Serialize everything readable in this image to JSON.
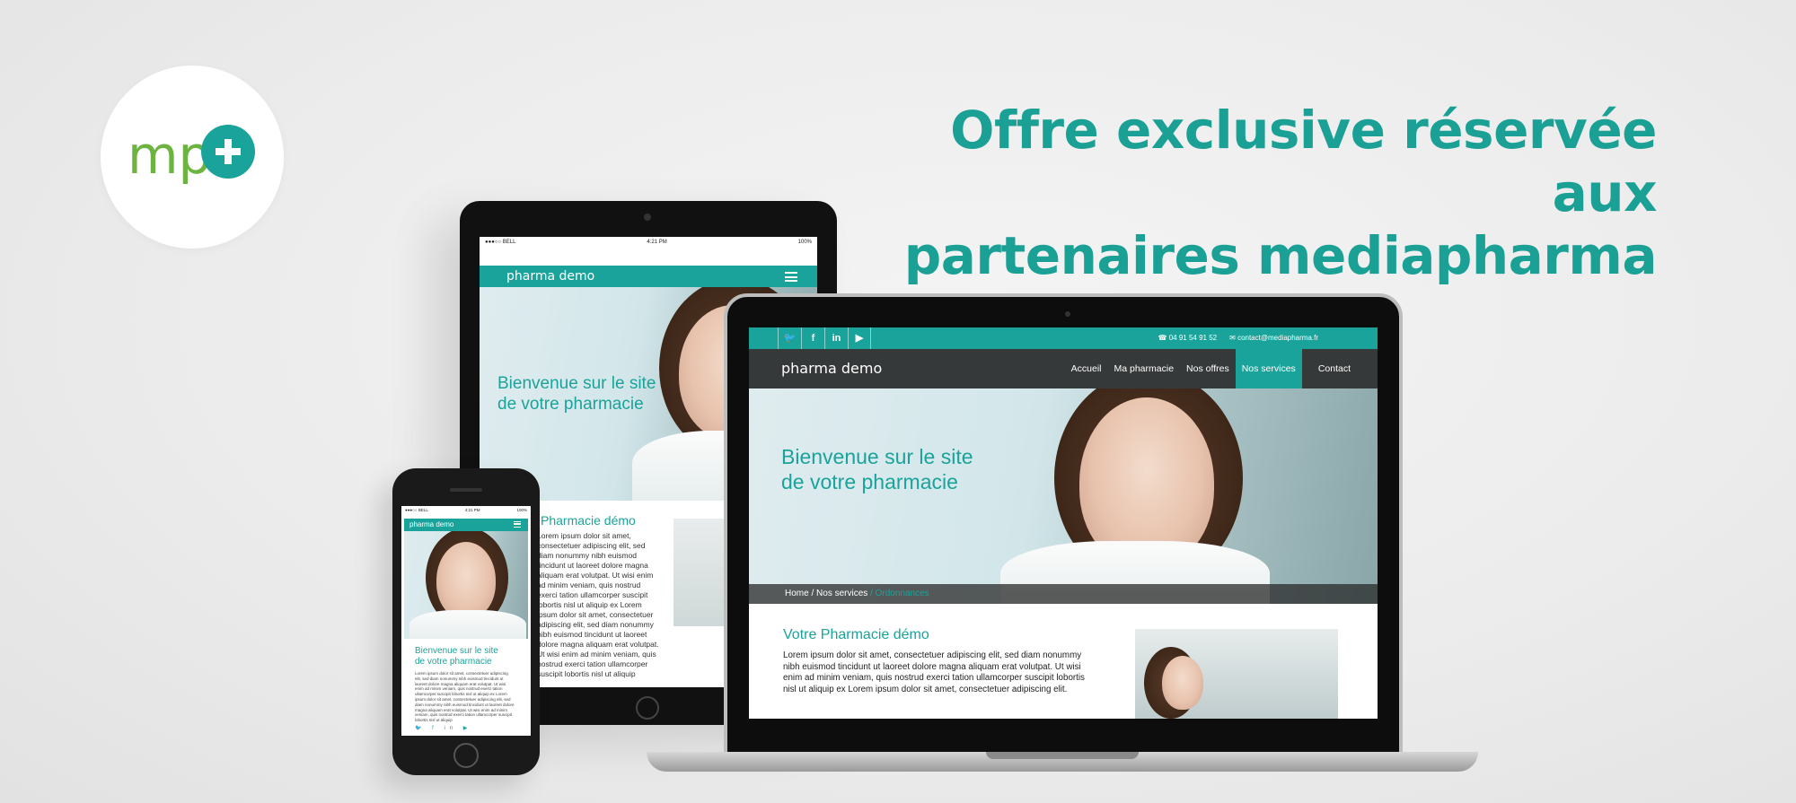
{
  "logo": {
    "text": "mp",
    "icon": "plus-icon"
  },
  "headline": {
    "line1": "Offre exclusive réservée aux",
    "line2": "partenaires mediapharma"
  },
  "colors": {
    "teal": "#1aa39a",
    "dark_nav": "#363939",
    "logo_green": "#6cb33f"
  },
  "tablet": {
    "status": {
      "carrier": "●●●○○ BELL",
      "time": "4:21 PM",
      "battery": "100%"
    },
    "brand": "pharma demo",
    "welcome": [
      "Bienvenue sur le site",
      "de votre pharmacie"
    ],
    "section_title": "Pharmacie démo",
    "section_text": "Lorem ipsum dolor sit amet, consectetuer adipiscing elit, sed diam nonummy nibh euismod tincidunt ut laoreet dolore magna aliquam erat volutpat. Ut wisi enim ad minim veniam, quis nostrud exerci tation ullamcorper suscipit lobortis nisl ut aliquip ex Lorem ipsum dolor sit amet, consectetuer adipiscing elit, sed diam nonummy nibh euismod tincidunt ut laoreet dolore magna aliquam erat volutpat. Ut wisi enim ad minim veniam, quis nostrud exerci tation ullamcorper suscipit lobortis nisl ut aliquip"
  },
  "phone": {
    "status": {
      "carrier": "●●●○○ BELL",
      "time": "4:21 PM",
      "battery": "100%"
    },
    "brand": "pharma demo",
    "welcome": [
      "Bienvenue sur le site",
      "de votre pharmacie"
    ],
    "text": "Lorem ipsum dolor sit amet, consectetuer adipiscing elit, sed diam nonummy nibh euismod tincidunt ut laoreet dolore magna aliquam erat volutpat. Ut wisi enim ad minim veniam, quis nostrud exerci tation ullamcorper suscipit lobortis nisl ut aliquip ex Lorem ipsum dolor sit amet, consectetuer adipiscing elit, sed diam nonummy nibh euismod tincidunt ut laoreet dolore magna aliquam erat volutpat. Ut wisi enim ad minim veniam, quis nostrud exerci tation ullamcorper suscipit lobortis nisl ut aliquip",
    "social": "🐦 f in ▶"
  },
  "laptop": {
    "social_icons": [
      "twitter-icon",
      "facebook-icon",
      "linkedin-icon",
      "youtube-icon"
    ],
    "social_glyphs": [
      "🐦",
      "f",
      "in",
      "▶"
    ],
    "phone": "04 91 54 91 52",
    "email": "contact@mediapharma.fr",
    "brand": "pharma demo",
    "menu": [
      "Accueil",
      "Ma pharmacie",
      "Nos offres",
      "Nos services",
      "Contact"
    ],
    "active_menu": "Nos services",
    "welcome": [
      "Bienvenue sur le site",
      "de votre pharmacie"
    ],
    "breadcrumb": {
      "home": "Home",
      "sep": "/",
      "section": "Nos services",
      "current": "Ordonnances"
    },
    "content_title": "Votre Pharmacie démo",
    "content_text": "Lorem ipsum dolor sit amet, consectetuer adipiscing elit, sed diam nonummy nibh euismod tincidunt ut laoreet dolore magna aliquam erat volutpat. Ut wisi enim ad minim veniam, quis nostrud exerci tation ullamcorper suscipit lobortis nisl ut aliquip ex Lorem ipsum dolor sit amet, consectetuer adipiscing elit."
  }
}
